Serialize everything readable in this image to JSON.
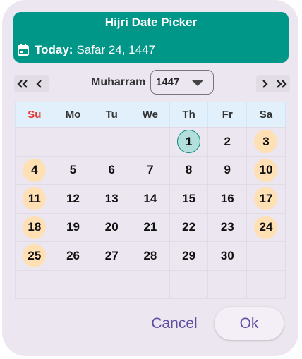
{
  "dialog": {
    "title": "Hijri Date Picker",
    "today_label": "Today:",
    "today_value": "Safar 24, 1447",
    "icons": {
      "calendar": "calendar-icon",
      "first": "double-chevron-left-icon",
      "prev": "chevron-left-icon",
      "next": "chevron-right-icon",
      "last": "double-chevron-right-icon",
      "dropdown": "caret-down-icon"
    }
  },
  "calendar": {
    "month": "Muharram",
    "year": "1447",
    "weekdays": [
      "Su",
      "Mo",
      "Tu",
      "We",
      "Th",
      "Fr",
      "Sa"
    ],
    "weeks": [
      [
        "",
        "",
        "",
        "",
        "1",
        "2",
        "3"
      ],
      [
        "4",
        "5",
        "6",
        "7",
        "8",
        "9",
        "10"
      ],
      [
        "11",
        "12",
        "13",
        "14",
        "15",
        "16",
        "17"
      ],
      [
        "18",
        "19",
        "20",
        "21",
        "22",
        "23",
        "24"
      ],
      [
        "25",
        "26",
        "27",
        "28",
        "29",
        "30",
        ""
      ],
      [
        "",
        "",
        "",
        "",
        "",
        "",
        ""
      ]
    ],
    "highlighted_day": "1"
  },
  "actions": {
    "cancel": "Cancel",
    "ok": "Ok"
  },
  "colors": {
    "header": "#009688",
    "today_highlight": "#b2dfdb",
    "weekend_highlight": "#ffdfb4",
    "sunday_label": "#e53935",
    "accent": "#5e4ea0",
    "dialog_bg": "#ece6f0"
  }
}
